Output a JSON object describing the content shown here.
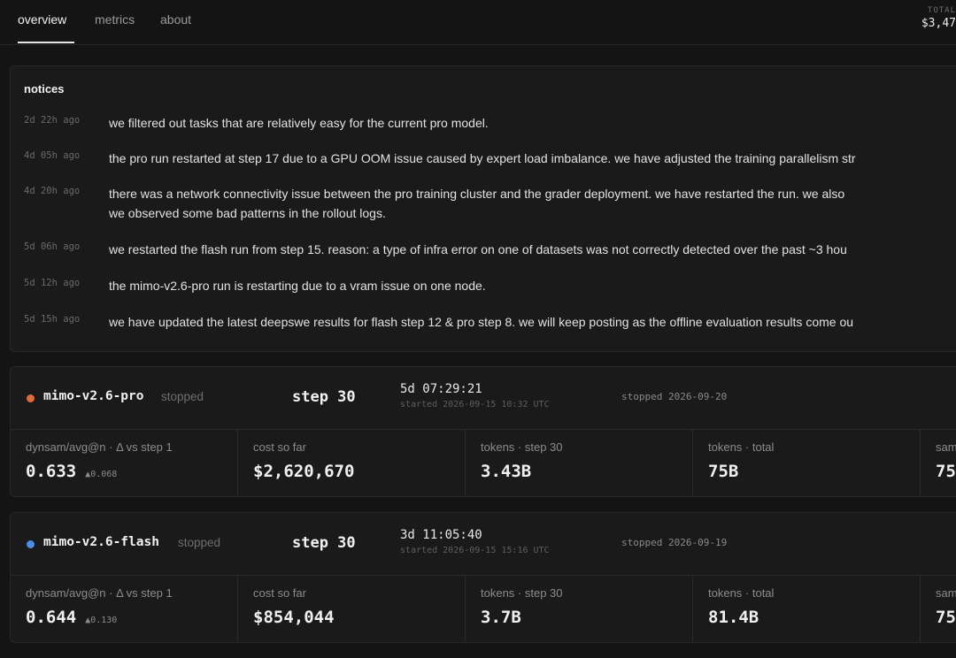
{
  "nav": {
    "tabs": [
      {
        "label": "overview",
        "active": true
      },
      {
        "label": "metrics",
        "active": false
      },
      {
        "label": "about",
        "active": false
      }
    ],
    "total_label": "TOTAL",
    "total_value": "$3,47"
  },
  "notices": {
    "title": "notices",
    "items": [
      {
        "time": "2d 22h ago",
        "text": "we filtered out tasks that are relatively easy for the current pro model."
      },
      {
        "time": "4d 05h ago",
        "text": "the pro run restarted at step 17 due to a GPU OOM issue caused by expert load imbalance. we have adjusted the training parallelism str"
      },
      {
        "time": "4d 20h ago",
        "text": "there was a network connectivity issue between the pro training cluster and the grader deployment. we have restarted the run. we also",
        "text2": "we observed some bad patterns in the rollout logs."
      },
      {
        "time": "5d 06h ago",
        "text": "we restarted the flash run from step 15. reason: a type of infra error on one of datasets was not correctly detected over the past ~3 hou"
      },
      {
        "time": "5d 12h ago",
        "text": "the mimo-v2.6-pro run is restarting due to a vram issue on one node."
      },
      {
        "time": "5d 15h ago",
        "text": "we have updated the latest deepswe results for flash step 12 & pro step 8. we will keep posting as the offline evaluation results come ou"
      }
    ]
  },
  "runs": [
    {
      "dot_color": "#e06a3a",
      "name": "mimo-v2.6-pro",
      "status": "stopped",
      "step": "step 30",
      "elapsed": "5d 07:29:21",
      "started": "started 2026-09-15 10:32 UTC",
      "stopped": "stopped 2026-09-20",
      "stats": [
        {
          "label": "dynsam/avg@n · Δ vs step 1",
          "value": "0.633",
          "delta": "▲0.068"
        },
        {
          "label": "cost so far",
          "value": "$2,620,670"
        },
        {
          "label": "tokens · step 30",
          "value": "3.43B"
        },
        {
          "label": "tokens · total",
          "value": "75B"
        },
        {
          "label": "sam",
          "value": "75"
        }
      ]
    },
    {
      "dot_color": "#4a8ee6",
      "name": "mimo-v2.6-flash",
      "status": "stopped",
      "step": "step 30",
      "elapsed": "3d 11:05:40",
      "started": "started 2026-09-15 15:16 UTC",
      "stopped": "stopped 2026-09-19",
      "stats": [
        {
          "label": "dynsam/avg@n · Δ vs step 1",
          "value": "0.644",
          "delta": "▲0.130"
        },
        {
          "label": "cost so far",
          "value": "$854,044"
        },
        {
          "label": "tokens · step 30",
          "value": "3.7B"
        },
        {
          "label": "tokens · total",
          "value": "81.4B"
        },
        {
          "label": "sam",
          "value": "75"
        }
      ]
    }
  ]
}
